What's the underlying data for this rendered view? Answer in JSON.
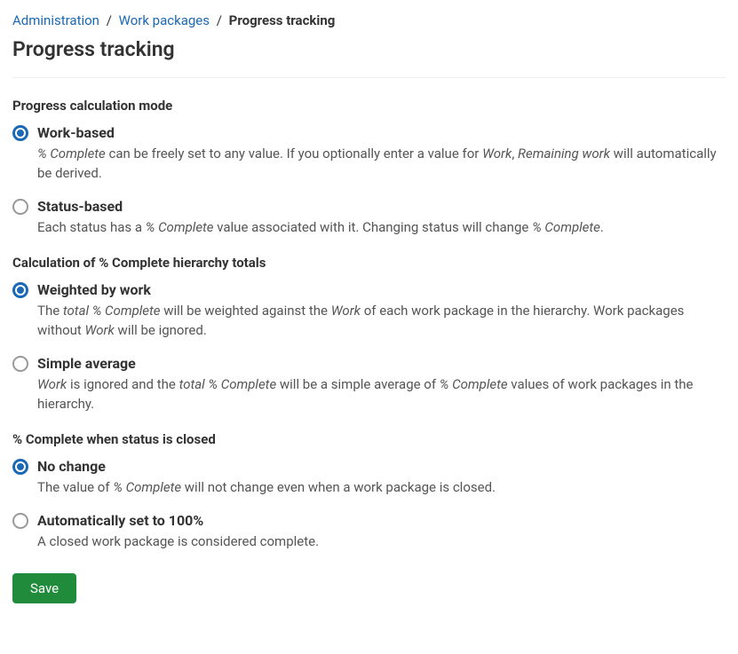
{
  "breadcrumb": {
    "items": [
      {
        "label": "Administration",
        "link": true
      },
      {
        "label": "Work packages",
        "link": true
      },
      {
        "label": "Progress tracking",
        "link": false
      }
    ]
  },
  "page_title": "Progress tracking",
  "sections": {
    "mode": {
      "heading": "Progress calculation mode",
      "options": {
        "work_based": {
          "label": "Work-based",
          "description_html": "<em>% Complete</em> can be freely set to any value. If you optionally enter a value for <em>Work</em>, <em>Remaining work</em> will automatically be derived."
        },
        "status_based": {
          "label": "Status-based",
          "description_html": "Each status has a <em>% Complete</em> value associated with it. Changing status will change <em>% Complete</em>."
        }
      }
    },
    "hierarchy": {
      "heading": "Calculation of % Complete hierarchy totals",
      "options": {
        "weighted": {
          "label": "Weighted by work",
          "description_html": "The <em>total % Complete</em> will be weighted against the <em>Work</em> of each work package in the hierarchy. Work packages without <em>Work</em> will be ignored."
        },
        "simple": {
          "label": "Simple average",
          "description_html": "<em>Work</em> is ignored and the <em>total % Complete</em> will be a simple average of <em>% Complete</em> values of work packages in the hierarchy."
        }
      }
    },
    "closed": {
      "heading": "% Complete when status is closed",
      "options": {
        "no_change": {
          "label": "No change",
          "description_html": "The value of <em>% Complete</em> will not change even when a work package is closed."
        },
        "auto_100": {
          "label": "Automatically set to 100%",
          "description_html": "A closed work package is considered complete."
        }
      }
    }
  },
  "save_label": "Save"
}
